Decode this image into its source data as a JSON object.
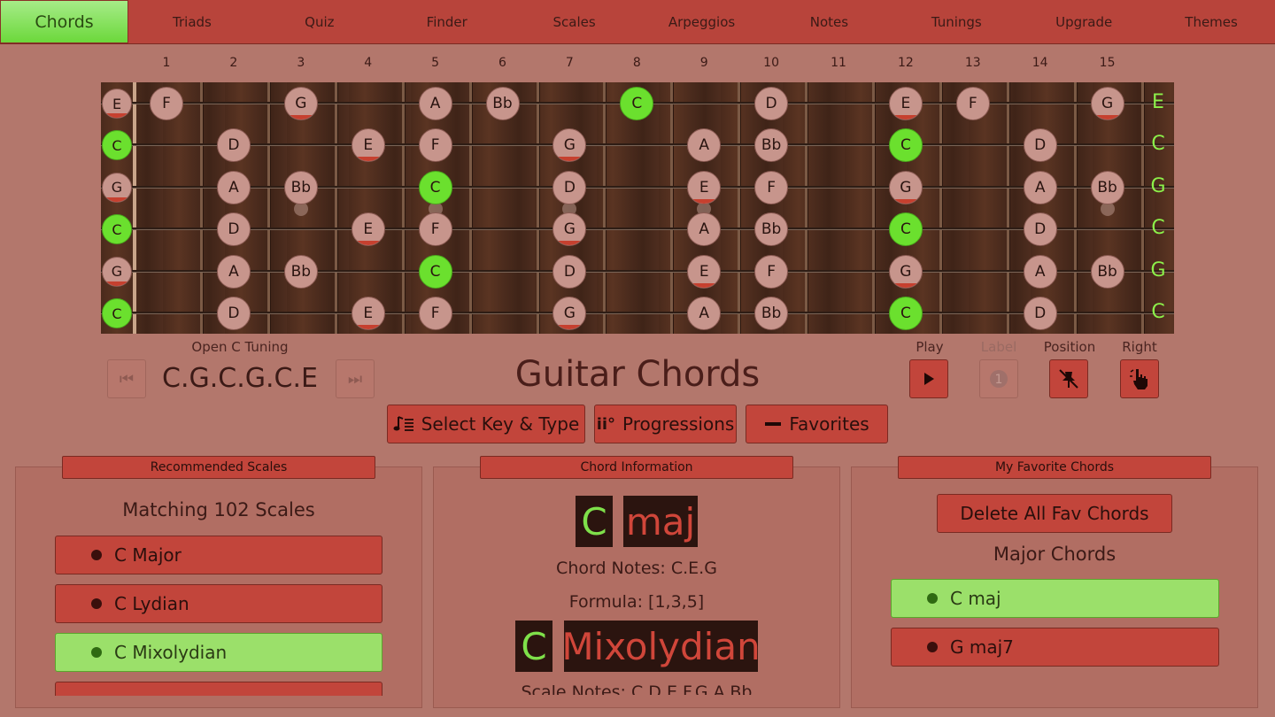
{
  "tabs": [
    "Chords",
    "Triads",
    "Quiz",
    "Finder",
    "Scales",
    "Arpeggios",
    "Notes",
    "Tunings",
    "Upgrade",
    "Themes"
  ],
  "fret_numbers": [
    "1",
    "2",
    "3",
    "4",
    "5",
    "6",
    "7",
    "8",
    "9",
    "10",
    "11",
    "12",
    "13",
    "14",
    "15"
  ],
  "open_string_labels": [
    "E",
    "C",
    "G",
    "C",
    "G",
    "C"
  ],
  "fretboard_notes": [
    [
      {
        "f": 0,
        "n": "E",
        "r": true
      },
      {
        "f": 1,
        "n": "F"
      },
      {
        "f": 3,
        "n": "G",
        "r": true
      },
      {
        "f": 5,
        "n": "A"
      },
      {
        "f": 6,
        "n": "Bb"
      },
      {
        "f": 8,
        "n": "C",
        "root": true
      },
      {
        "f": 10,
        "n": "D"
      },
      {
        "f": 12,
        "n": "E",
        "r": true
      },
      {
        "f": 13,
        "n": "F"
      },
      {
        "f": 15,
        "n": "G",
        "r": true
      }
    ],
    [
      {
        "f": 0,
        "n": "C",
        "root": true
      },
      {
        "f": 2,
        "n": "D"
      },
      {
        "f": 4,
        "n": "E",
        "r": true
      },
      {
        "f": 5,
        "n": "F"
      },
      {
        "f": 7,
        "n": "G",
        "r": true
      },
      {
        "f": 9,
        "n": "A"
      },
      {
        "f": 10,
        "n": "Bb"
      },
      {
        "f": 12,
        "n": "C",
        "root": true
      },
      {
        "f": 14,
        "n": "D"
      }
    ],
    [
      {
        "f": 0,
        "n": "G",
        "r": true
      },
      {
        "f": 2,
        "n": "A"
      },
      {
        "f": 3,
        "n": "Bb"
      },
      {
        "f": 5,
        "n": "C",
        "root": true
      },
      {
        "f": 7,
        "n": "D"
      },
      {
        "f": 9,
        "n": "E",
        "r": true
      },
      {
        "f": 10,
        "n": "F"
      },
      {
        "f": 12,
        "n": "G",
        "r": true
      },
      {
        "f": 14,
        "n": "A"
      },
      {
        "f": 15,
        "n": "Bb"
      }
    ],
    [
      {
        "f": 0,
        "n": "C",
        "root": true
      },
      {
        "f": 2,
        "n": "D"
      },
      {
        "f": 4,
        "n": "E",
        "r": true
      },
      {
        "f": 5,
        "n": "F"
      },
      {
        "f": 7,
        "n": "G",
        "r": true
      },
      {
        "f": 9,
        "n": "A"
      },
      {
        "f": 10,
        "n": "Bb"
      },
      {
        "f": 12,
        "n": "C",
        "root": true
      },
      {
        "f": 14,
        "n": "D"
      }
    ],
    [
      {
        "f": 0,
        "n": "G",
        "r": true
      },
      {
        "f": 2,
        "n": "A"
      },
      {
        "f": 3,
        "n": "Bb"
      },
      {
        "f": 5,
        "n": "C",
        "root": true
      },
      {
        "f": 7,
        "n": "D"
      },
      {
        "f": 9,
        "n": "E",
        "r": true
      },
      {
        "f": 10,
        "n": "F"
      },
      {
        "f": 12,
        "n": "G",
        "r": true
      },
      {
        "f": 14,
        "n": "A"
      },
      {
        "f": 15,
        "n": "Bb"
      }
    ],
    [
      {
        "f": 0,
        "n": "C",
        "root": true
      },
      {
        "f": 2,
        "n": "D"
      },
      {
        "f": 4,
        "n": "E",
        "r": true
      },
      {
        "f": 5,
        "n": "F"
      },
      {
        "f": 7,
        "n": "G",
        "r": true
      },
      {
        "f": 9,
        "n": "A"
      },
      {
        "f": 10,
        "n": "Bb"
      },
      {
        "f": 12,
        "n": "C",
        "root": true
      },
      {
        "f": 14,
        "n": "D"
      }
    ]
  ],
  "tuning": {
    "caption": "Open C Tuning",
    "value": "C.G.C.G.C.E"
  },
  "app_title": "Guitar Chords",
  "controls": {
    "play": "Play",
    "label": "Label",
    "position": "Position",
    "right": "Right"
  },
  "buttons": {
    "select_key": "Select Key & Type",
    "progressions": "Progressions",
    "favorites": "Favorites"
  },
  "recommended": {
    "title": "Recommended Scales",
    "heading": "Matching 102 Scales",
    "items": [
      {
        "label": "C Major",
        "selected": false
      },
      {
        "label": "C Lydian",
        "selected": false
      },
      {
        "label": "C Mixolydian",
        "selected": true
      }
    ]
  },
  "chord_info": {
    "title": "Chord Information",
    "root": "C",
    "type": "maj",
    "notes": "Chord Notes: C.E.G",
    "formula": "Formula: [1,3,5]",
    "scale_root": "C",
    "scale_name": "Mixolydian",
    "scale_notes": "Scale Notes: C.D.E.F.G.A.Bb"
  },
  "favorites": {
    "title": "My Favorite Chords",
    "delete_label": "Delete All Fav Chords",
    "heading": "Major Chords",
    "items": [
      {
        "label": "C maj",
        "selected": true
      },
      {
        "label": "G maj7",
        "selected": false
      }
    ]
  },
  "colors": {
    "accent_green": "#6be02e",
    "tab_red": "#c2453b",
    "background": "#b3776c"
  }
}
